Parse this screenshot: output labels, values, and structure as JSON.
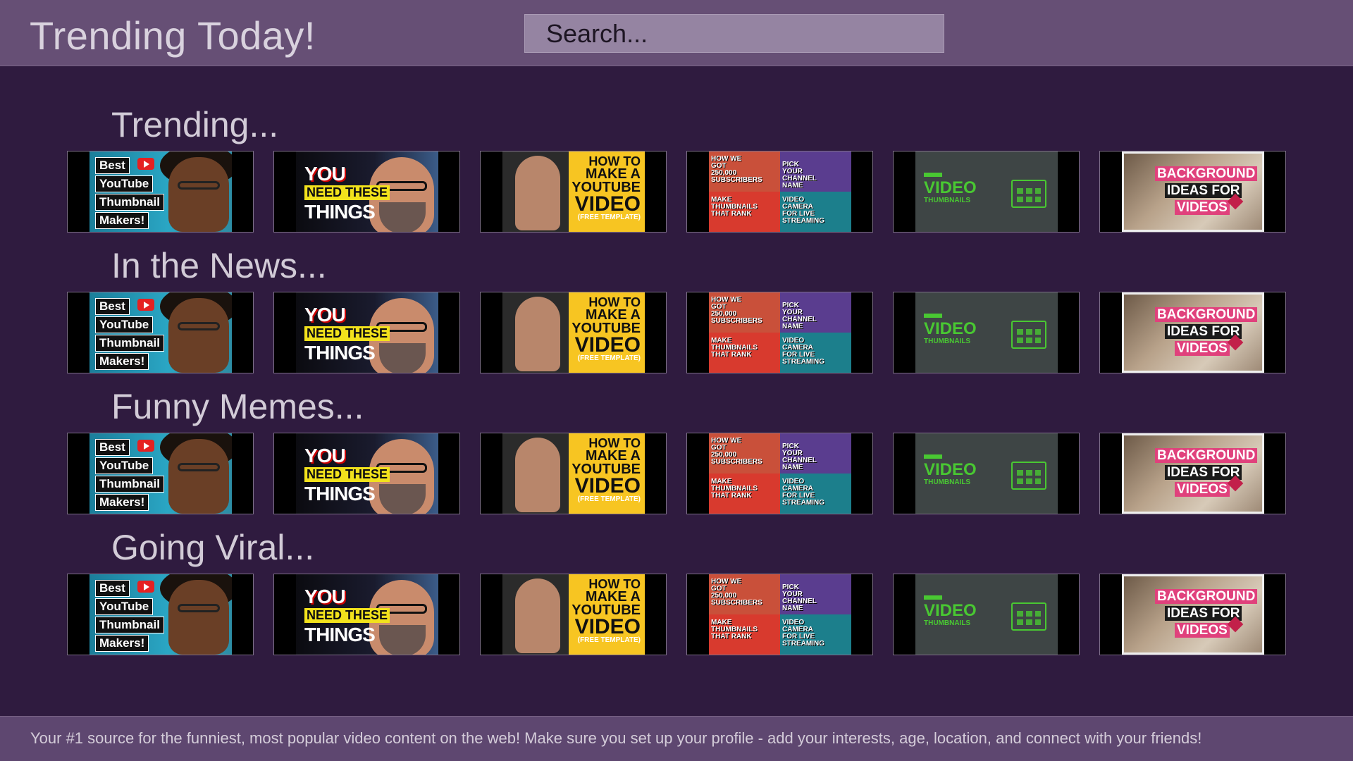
{
  "header": {
    "title": "Trending Today!",
    "search_placeholder": "Search..."
  },
  "thumbnails": [
    {
      "icon": "best-youtube-thumbnail-makers-thumb",
      "lines": [
        "Best",
        "YouTube",
        "Thumbnail",
        "Makers!"
      ]
    },
    {
      "icon": "you-need-these-things-thumb",
      "lines": [
        "YOU",
        "NEED THESE",
        "THINGS"
      ]
    },
    {
      "icon": "how-to-make-a-youtube-video-thumb",
      "lines": [
        "HOW TO",
        "MAKE A",
        "YOUTUBE",
        "VIDEO",
        "(FREE TEMPLATE)"
      ]
    },
    {
      "icon": "channel-collage-thumb",
      "lines": [
        "HOW WE GOT 250,000 SUBSCRIBERS",
        "PICK YOUR CHANNEL NAME",
        "MAKE THUMBNAILS THAT RANK",
        "VIDEO CAMERA FOR LIVE STREAMING"
      ]
    },
    {
      "icon": "video-thumbnails-thumb",
      "lines": [
        "VIDEO",
        "THUMBNAILS"
      ]
    },
    {
      "icon": "background-ideas-for-videos-thumb",
      "lines": [
        "BACKGROUND",
        "IDEAS FOR",
        "VIDEOS"
      ]
    }
  ],
  "sections": [
    {
      "title": "Trending..."
    },
    {
      "title": "In the News..."
    },
    {
      "title": "Funny Memes..."
    },
    {
      "title": "Going Viral..."
    }
  ],
  "footer": {
    "text": "Your #1 source for the funniest, most popular video content on the web! Make sure you set up your profile - add your interests, age, location, and connect with your friends!"
  },
  "colors": {
    "background": "#2f1b3f",
    "header": "#664f75",
    "search": "#9584a2",
    "footer": "#5e4770"
  }
}
